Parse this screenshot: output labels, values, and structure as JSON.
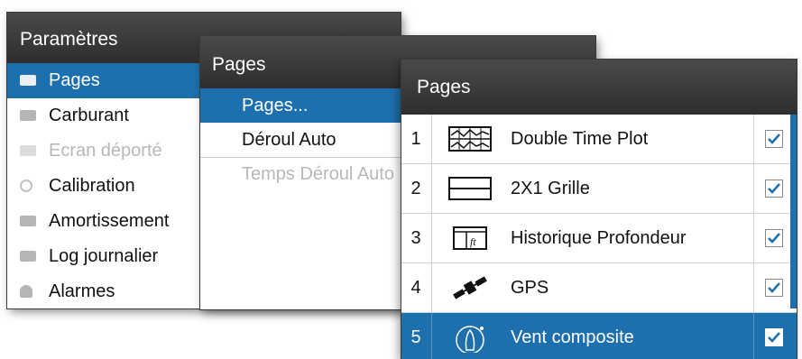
{
  "settings_panel": {
    "title": "Paramètres",
    "items": [
      {
        "label": "Pages"
      },
      {
        "label": "Carburant"
      },
      {
        "label": "Ecran déporté"
      },
      {
        "label": "Calibration"
      },
      {
        "label": "Amortissement"
      },
      {
        "label": "Log journalier"
      },
      {
        "label": "Alarmes"
      }
    ]
  },
  "pages_menu": {
    "title": "Pages",
    "items": [
      {
        "label": "Pages..."
      },
      {
        "label": "Déroul Auto"
      },
      {
        "label": "Temps Déroul Auto"
      }
    ]
  },
  "pages_list": {
    "title": "Pages",
    "rows": [
      {
        "num": "1",
        "label": "Double Time Plot",
        "icon": "double-time-plot-icon",
        "checked": true
      },
      {
        "num": "2",
        "label": "2X1 Grille",
        "icon": "grid-2x1-icon",
        "checked": true
      },
      {
        "num": "3",
        "label": "Historique Profondeur",
        "icon": "depth-history-icon",
        "icon_text": "ft",
        "checked": true
      },
      {
        "num": "4",
        "label": "GPS",
        "icon": "satellite-icon",
        "checked": true
      },
      {
        "num": "5",
        "label": "Vent composite",
        "icon": "boat-wind-icon",
        "checked": true
      }
    ]
  },
  "colors": {
    "accent": "#1e6fad",
    "header_bg": "#3a3a3a",
    "disabled_text": "#b8b8b8"
  }
}
